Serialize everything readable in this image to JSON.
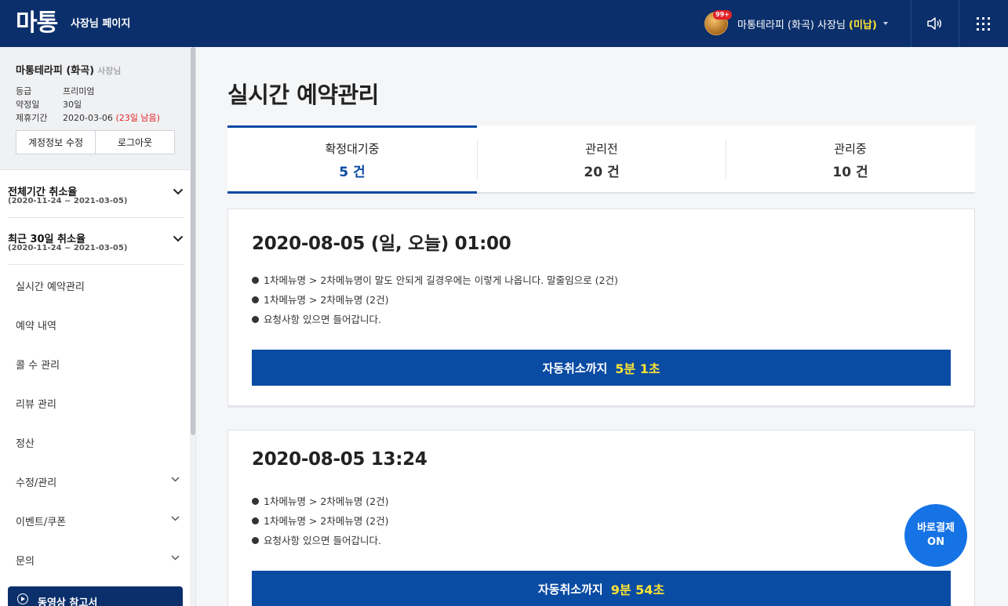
{
  "header": {
    "logo": "마통",
    "subtitle": "사장님 페이지",
    "badge": "99+",
    "user_name": "마통테라피 (화곡) 사장님",
    "user_status": "(미납)"
  },
  "account": {
    "name": "마통테라피 (화곡)",
    "role": "사장님",
    "grade_label": "등급",
    "grade_value": "프리미엄",
    "contract_label": "약정일",
    "contract_value": "30일",
    "period_label": "제휴기간",
    "period_value": "2020-03-06",
    "period_remaining": "(23일 남음)",
    "edit_label": "계정정보 수정",
    "logout_label": "로그아웃"
  },
  "stats": [
    {
      "title": "전체기간 취소율",
      "range": "(2020-11-24 ~ 2021-03-05)"
    },
    {
      "title": "최근 30일 취소율",
      "range": "(2020-11-24 ~ 2021-03-05)"
    }
  ],
  "nav": [
    {
      "label": "실시간 예약관리"
    },
    {
      "label": "예약 내역"
    },
    {
      "label": "콜 수 관리"
    },
    {
      "label": "리뷰 관리"
    },
    {
      "label": "정산"
    },
    {
      "label": "수정/관리"
    },
    {
      "label": "이벤트/쿠폰"
    },
    {
      "label": "문의"
    }
  ],
  "video_label": "동영상 참고서",
  "page_title": "실시간 예약관리",
  "tabs": [
    {
      "label": "확정대기중",
      "count": "5 건"
    },
    {
      "label": "관리전",
      "count": "20 건"
    },
    {
      "label": "관리중",
      "count": "10 건"
    }
  ],
  "cards": [
    {
      "date": "2020-08-05 (일, 오늘)  01:00",
      "items": [
        "1차메뉴명 > 2차메뉴명이 말도 안되게 길경우에는 이렇게 나옵니다. 말줄임으로 (2건)",
        "1차메뉴명 > 2차메뉴명 (2건)",
        "요청사항 있으면 들어갑니다."
      ],
      "cancel_label": "자동취소까지",
      "cancel_time": "5분 1초"
    },
    {
      "date": "2020-08-05  13:24",
      "items": [
        "1차메뉴명 > 2차메뉴명 (2건)",
        "1차메뉴명 > 2차메뉴명 (2건)",
        "요청사항 있으면 들어갑니다."
      ],
      "cancel_label": "자동취소까지",
      "cancel_time": "9분 54초"
    }
  ],
  "fab": {
    "line1": "바로결제",
    "line2": "ON"
  },
  "colors": {
    "header_bg": "#0b2f6b",
    "accent": "#0a4ba3",
    "highlight": "#ffe533",
    "warn": "#e2232a",
    "fab": "#1673e6"
  },
  "icons": [
    "avatar-image",
    "caret-down-icon",
    "speaker-icon",
    "app-grid-icon",
    "chevron-down-icon",
    "play-circle-icon"
  ]
}
